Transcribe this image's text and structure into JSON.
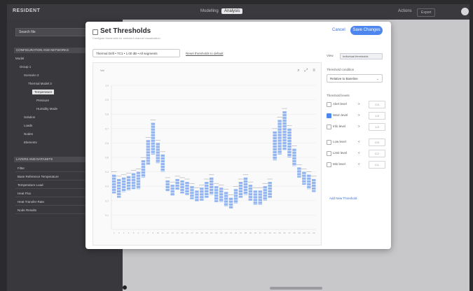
{
  "app": {
    "logo": "RESIDENT",
    "tabs": [
      "Modelling",
      "Analysis"
    ],
    "active_tab": 1,
    "top_right_button": "Export",
    "top_right_link": "Actions"
  },
  "left_panel": {
    "search_value": "Search file",
    "sections": [
      {
        "title": "CONFIGURATION AND NETWORKS"
      },
      {
        "title": "LAYERS AND DATASETS"
      }
    ],
    "tree": [
      {
        "label": "Model",
        "indent": 0,
        "selected": false
      },
      {
        "label": "Group 1",
        "indent": 1,
        "selected": false
      },
      {
        "label": "Scenario 2",
        "indent": 2,
        "selected": false
      },
      {
        "label": "Thermal Model 3",
        "indent": 3,
        "selected": false
      },
      {
        "label": "Temperature",
        "indent": 4,
        "selected": true
      },
      {
        "label": "Pressure",
        "indent": 5,
        "selected": false
      },
      {
        "label": "Humidity Mode",
        "indent": 5,
        "selected": false
      },
      {
        "label": "Solution",
        "indent": 2,
        "selected": false
      },
      {
        "label": "Loads",
        "indent": 2,
        "selected": false
      },
      {
        "label": "Nodes",
        "indent": 2,
        "selected": false
      },
      {
        "label": "Elements",
        "indent": 2,
        "selected": false
      }
    ],
    "layer_rows": [
      "Filter",
      "Base Reference Temperature",
      "Temperature Load",
      "Heat Flux",
      "Heat Transfer Rate",
      "Node Results"
    ]
  },
  "modal": {
    "title": "Set Thresholds",
    "subtitle": "Configure thresholds for selected channel visualization",
    "cancel_label": "Cancel",
    "save_label": "Save Changes",
    "select_value": "Thermal Drift • TC1 • 1.00 dB • All segments",
    "link_label": "Reset thresholds to default",
    "chart_tools": [
      "⌕",
      "⤢",
      "≡"
    ],
    "side": {
      "view_label": "View",
      "view_badge": "Individual thresholds",
      "dropdown_label": "Threshold condition",
      "dropdown_value": "Relative to Baseline",
      "thresholds_label": "Threshold levels",
      "rows": [
        {
          "name": "Alert level",
          "op": ">",
          "value": "2.0",
          "checked": false
        },
        {
          "name": "Warn level",
          "op": ">",
          "value": "1.5",
          "checked": true
        },
        {
          "name": "Info level",
          "op": ">",
          "value": "1.0",
          "checked": false
        },
        {
          "name": "Low level",
          "op": "<",
          "value": "0.5",
          "checked": false
        },
        {
          "name": "Limit level",
          "op": "<",
          "value": "0.2",
          "checked": false
        },
        {
          "name": "Min level",
          "op": "<",
          "value": "0.1",
          "checked": false
        }
      ],
      "add_link": "Add New Threshold"
    }
  },
  "chart_data": {
    "type": "bar",
    "ylabel": "Val",
    "ylim": [
      0,
      1.0
    ],
    "yticks": [
      0.1,
      0.2,
      0.3,
      0.4,
      0.5,
      0.6,
      0.7,
      0.8,
      0.9,
      1.0
    ],
    "categories": [
      "1",
      "2",
      "3",
      "4",
      "5",
      "6",
      "7",
      "8",
      "9",
      "10",
      "11",
      "12",
      "13",
      "14",
      "15",
      "16",
      "17",
      "18",
      "19",
      "20",
      "21",
      "22",
      "23",
      "24",
      "25",
      "26",
      "27",
      "28",
      "29",
      "30",
      "31",
      "32",
      "33",
      "34",
      "35",
      "36",
      "37",
      "38",
      "39",
      "40",
      "41",
      "42"
    ],
    "bands": [
      [
        0.25,
        0.38
      ],
      [
        0.22,
        0.35
      ],
      [
        0.26,
        0.36
      ],
      [
        0.27,
        0.37
      ],
      [
        0.28,
        0.39
      ],
      [
        0.28,
        0.4
      ],
      [
        0.36,
        0.48
      ],
      [
        0.45,
        0.62
      ],
      [
        0.52,
        0.74
      ],
      [
        0.46,
        0.6
      ],
      [
        0.4,
        0.52
      ],
      [
        0.26,
        0.34
      ],
      [
        0.23,
        0.31
      ],
      [
        0.27,
        0.35
      ],
      [
        0.25,
        0.34
      ],
      [
        0.24,
        0.33
      ],
      [
        0.21,
        0.3
      ],
      [
        0.19,
        0.27
      ],
      [
        0.2,
        0.29
      ],
      [
        0.22,
        0.33
      ],
      [
        0.24,
        0.36
      ],
      [
        0.19,
        0.3
      ],
      [
        0.19,
        0.29
      ],
      [
        0.16,
        0.26
      ],
      [
        0.14,
        0.22
      ],
      [
        0.18,
        0.28
      ],
      [
        0.22,
        0.33
      ],
      [
        0.24,
        0.36
      ],
      [
        0.2,
        0.31
      ],
      [
        0.17,
        0.27
      ],
      [
        0.17,
        0.27
      ],
      [
        0.2,
        0.3
      ],
      [
        0.22,
        0.33
      ],
      [
        0.48,
        0.68
      ],
      [
        0.52,
        0.76
      ],
      [
        0.55,
        0.82
      ],
      [
        0.5,
        0.7
      ],
      [
        0.44,
        0.56
      ],
      [
        0.36,
        0.43
      ],
      [
        0.31,
        0.4
      ],
      [
        0.28,
        0.38
      ],
      [
        0.26,
        0.35
      ]
    ]
  }
}
